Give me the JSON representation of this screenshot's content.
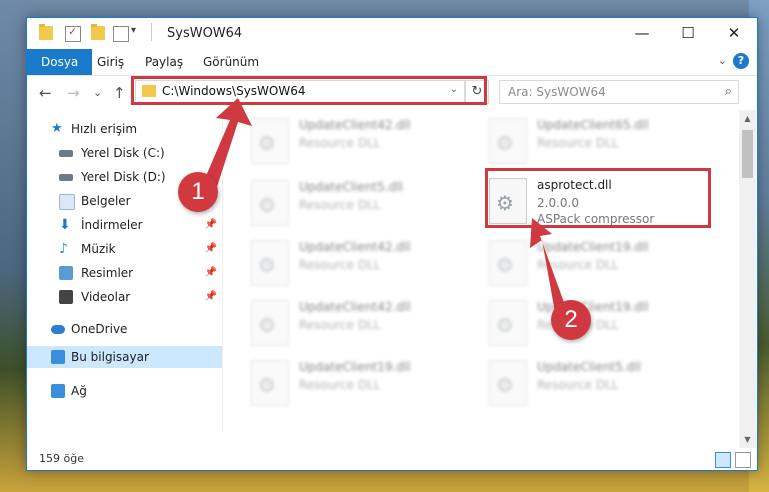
{
  "window": {
    "title": "SysWOW64",
    "qa_dropdown": "▾",
    "minimize": "—",
    "maximize": "☐",
    "close": "✕"
  },
  "ribbon": {
    "tabs": [
      "Dosya",
      "Giriş",
      "Paylaş",
      "Görünüm"
    ],
    "active_tab": "Dosya",
    "collapse": "⌄",
    "help": "?"
  },
  "nav": {
    "back": "←",
    "forward": "→",
    "recent": "⌄",
    "up": "↑",
    "address": "C:\\Windows\\SysWOW64",
    "address_dropdown": "⌄",
    "refresh": "↻",
    "search_placeholder": "Ara: SysWOW64",
    "search_icon": "⌕"
  },
  "sidebar": {
    "items": [
      {
        "label": "Hızlı erişim",
        "icon": "star-icon",
        "color": "#1979ca",
        "pinned": false
      },
      {
        "label": "Yerel Disk (C:)",
        "icon": "drive-icon",
        "color": "#6d7b86",
        "pinned": true
      },
      {
        "label": "Yerel Disk (D:)",
        "icon": "drive-icon",
        "color": "#6d7b86",
        "pinned": true
      },
      {
        "label": "Belgeler",
        "icon": "documents-icon",
        "color": "#9ab6d6",
        "pinned": true
      },
      {
        "label": "İndirmeler",
        "icon": "downloads-icon",
        "color": "#1979ca",
        "pinned": true
      },
      {
        "label": "Müzik",
        "icon": "music-icon",
        "color": "#3b8ede",
        "pinned": true
      },
      {
        "label": "Resimler",
        "icon": "pictures-icon",
        "color": "#5a9bd5",
        "pinned": true
      },
      {
        "label": "Videolar",
        "icon": "videos-icon",
        "color": "#444444",
        "pinned": true
      },
      {
        "label": "OneDrive",
        "icon": "cloud-icon",
        "color": "#2d7dd2",
        "pinned": false
      },
      {
        "label": "Bu bilgisayar",
        "icon": "computer-icon",
        "color": "#3b8ede",
        "pinned": false,
        "selected": true
      },
      {
        "label": "Ağ",
        "icon": "network-icon",
        "color": "#3b8ede",
        "pinned": false
      }
    ],
    "pin_glyph": "📌"
  },
  "files": [
    {
      "name": "UpdateClient42.dll",
      "desc": "Resource DLL",
      "blurred": true
    },
    {
      "name": "UpdateClient65.dll",
      "desc": "Resource DLL",
      "blurred": true
    },
    {
      "name": "UpdateClient5.dll",
      "desc": "Resource DLL",
      "blurred": true
    },
    {
      "name": "asprotect.dll",
      "desc": "2.0.0.0",
      "desc2": "ASPack compressor",
      "blurred": false
    },
    {
      "name": "UpdateClient42.dll",
      "desc": "Resource DLL",
      "blurred": true
    },
    {
      "name": "UpdateClient19.dll",
      "desc": "Resource DLL",
      "blurred": true
    },
    {
      "name": "UpdateClient42.dll",
      "desc": "Resource DLL",
      "blurred": true
    },
    {
      "name": "UpdateClient19.dll",
      "desc": "Resource DLL",
      "blurred": true
    },
    {
      "name": "UpdateClient19.dll",
      "desc": "Resource DLL",
      "blurred": true
    },
    {
      "name": "UpdateClient5.dll",
      "desc": "Resource DLL",
      "blurred": true
    }
  ],
  "status": {
    "count": "159 öğe"
  },
  "callouts": {
    "one": "1",
    "two": "2"
  },
  "colors": {
    "accent": "#1979ca",
    "highlight": "#d0393f",
    "selected_bg": "#cce8ff"
  }
}
